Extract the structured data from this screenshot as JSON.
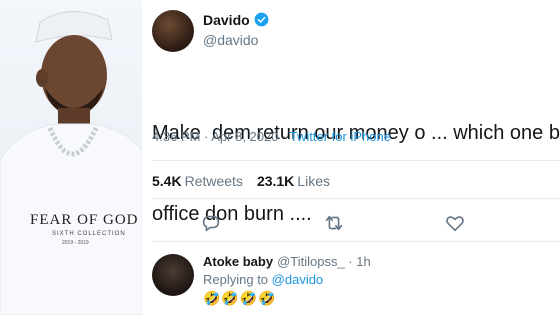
{
  "photo": {
    "shirt_brand": "FEAR OF GOD",
    "shirt_sub": "SIXTH COLLECTION",
    "shirt_years": "2019 - 2019"
  },
  "tweet": {
    "name": "Davido",
    "handle": "@davido",
    "text_line1": "Make  dem return our money o ... which one be",
    "text_line2": "office don burn ....",
    "time": "4:36 PM · Apr 8, 2020 · ",
    "source": "Twitter for iPhone",
    "retweets_count": "5.4K",
    "retweets_label": "Retweets",
    "likes_count": "23.1K",
    "likes_label": "Likes"
  },
  "reply": {
    "name": "Atoke baby",
    "handle": "@Titilopss_ · 1h",
    "replying_label": "Replying to ",
    "replying_to": "@davido",
    "text": "🤣🤣🤣🤣"
  },
  "colors": {
    "accent": "#1b95e0",
    "muted": "#657786",
    "text": "#14171a",
    "border": "#e6ecf0"
  }
}
